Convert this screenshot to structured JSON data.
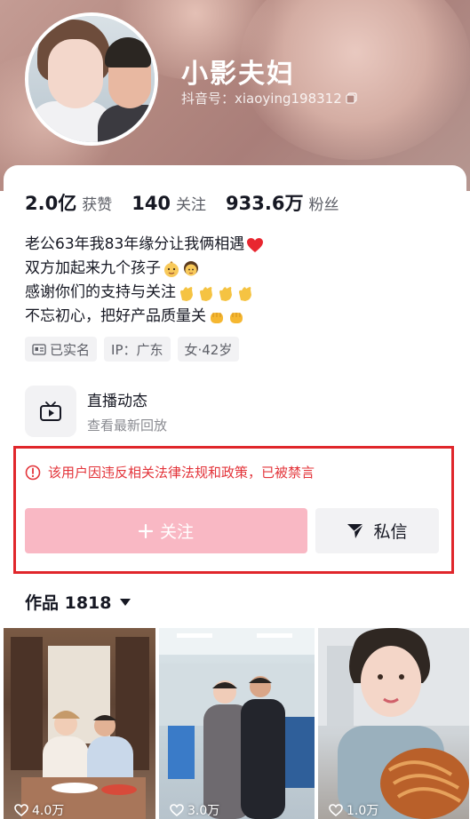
{
  "profile": {
    "nickname": "小影夫妇",
    "douyin_id": "抖音号：xiaoying198312"
  },
  "stats": [
    {
      "num": "2.0亿",
      "label": "获赞"
    },
    {
      "num": "140",
      "label": "关注"
    },
    {
      "num": "933.6万",
      "label": "粉丝"
    }
  ],
  "bio": {
    "line1": "老公63年我83年缘分让我俩相遇",
    "line2": "双方加起来九个孩子",
    "line3": "感谢你们的支持与关注",
    "line4": "不忘初心，把好产品质量关"
  },
  "tags": {
    "verified": "已实名",
    "ip": "IP：广东",
    "gender_age": "女·42岁"
  },
  "live": {
    "title": "直播动态",
    "subtitle": "查看最新回放"
  },
  "ban": {
    "message": "该用户因违反相关法律法规和政策，已被禁言",
    "highlight_color": "#e0262b"
  },
  "actions": {
    "follow_label": "关注",
    "message_label": "私信"
  },
  "works": {
    "header": "作品 1818",
    "items": [
      {
        "likes": "4.0万"
      },
      {
        "likes": "3.0万"
      },
      {
        "likes": "1.0万"
      }
    ]
  },
  "colors": {
    "follow_disabled": "#f9b8c4",
    "ban_text": "#e3343a"
  }
}
